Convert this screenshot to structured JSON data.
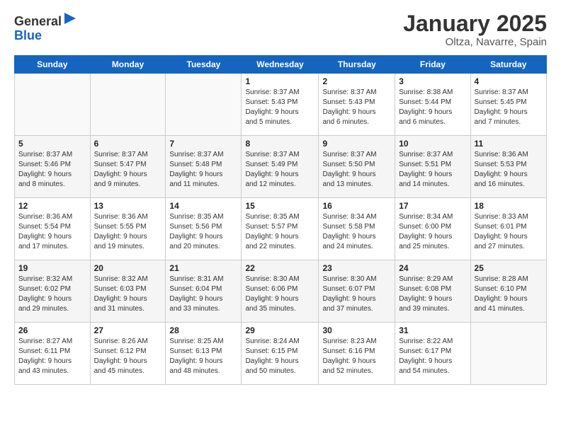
{
  "logo": {
    "general": "General",
    "blue": "Blue"
  },
  "title": "January 2025",
  "subtitle": "Oltza, Navarre, Spain",
  "weekdays": [
    "Sunday",
    "Monday",
    "Tuesday",
    "Wednesday",
    "Thursday",
    "Friday",
    "Saturday"
  ],
  "weeks": [
    [
      {
        "day": "",
        "info": ""
      },
      {
        "day": "",
        "info": ""
      },
      {
        "day": "",
        "info": ""
      },
      {
        "day": "1",
        "info": "Sunrise: 8:37 AM\nSunset: 5:43 PM\nDaylight: 9 hours\nand 5 minutes."
      },
      {
        "day": "2",
        "info": "Sunrise: 8:37 AM\nSunset: 5:43 PM\nDaylight: 9 hours\nand 6 minutes."
      },
      {
        "day": "3",
        "info": "Sunrise: 8:38 AM\nSunset: 5:44 PM\nDaylight: 9 hours\nand 6 minutes."
      },
      {
        "day": "4",
        "info": "Sunrise: 8:37 AM\nSunset: 5:45 PM\nDaylight: 9 hours\nand 7 minutes."
      }
    ],
    [
      {
        "day": "5",
        "info": "Sunrise: 8:37 AM\nSunset: 5:46 PM\nDaylight: 9 hours\nand 8 minutes."
      },
      {
        "day": "6",
        "info": "Sunrise: 8:37 AM\nSunset: 5:47 PM\nDaylight: 9 hours\nand 9 minutes."
      },
      {
        "day": "7",
        "info": "Sunrise: 8:37 AM\nSunset: 5:48 PM\nDaylight: 9 hours\nand 11 minutes."
      },
      {
        "day": "8",
        "info": "Sunrise: 8:37 AM\nSunset: 5:49 PM\nDaylight: 9 hours\nand 12 minutes."
      },
      {
        "day": "9",
        "info": "Sunrise: 8:37 AM\nSunset: 5:50 PM\nDaylight: 9 hours\nand 13 minutes."
      },
      {
        "day": "10",
        "info": "Sunrise: 8:37 AM\nSunset: 5:51 PM\nDaylight: 9 hours\nand 14 minutes."
      },
      {
        "day": "11",
        "info": "Sunrise: 8:36 AM\nSunset: 5:53 PM\nDaylight: 9 hours\nand 16 minutes."
      }
    ],
    [
      {
        "day": "12",
        "info": "Sunrise: 8:36 AM\nSunset: 5:54 PM\nDaylight: 9 hours\nand 17 minutes."
      },
      {
        "day": "13",
        "info": "Sunrise: 8:36 AM\nSunset: 5:55 PM\nDaylight: 9 hours\nand 19 minutes."
      },
      {
        "day": "14",
        "info": "Sunrise: 8:35 AM\nSunset: 5:56 PM\nDaylight: 9 hours\nand 20 minutes."
      },
      {
        "day": "15",
        "info": "Sunrise: 8:35 AM\nSunset: 5:57 PM\nDaylight: 9 hours\nand 22 minutes."
      },
      {
        "day": "16",
        "info": "Sunrise: 8:34 AM\nSunset: 5:58 PM\nDaylight: 9 hours\nand 24 minutes."
      },
      {
        "day": "17",
        "info": "Sunrise: 8:34 AM\nSunset: 6:00 PM\nDaylight: 9 hours\nand 25 minutes."
      },
      {
        "day": "18",
        "info": "Sunrise: 8:33 AM\nSunset: 6:01 PM\nDaylight: 9 hours\nand 27 minutes."
      }
    ],
    [
      {
        "day": "19",
        "info": "Sunrise: 8:32 AM\nSunset: 6:02 PM\nDaylight: 9 hours\nand 29 minutes."
      },
      {
        "day": "20",
        "info": "Sunrise: 8:32 AM\nSunset: 6:03 PM\nDaylight: 9 hours\nand 31 minutes."
      },
      {
        "day": "21",
        "info": "Sunrise: 8:31 AM\nSunset: 6:04 PM\nDaylight: 9 hours\nand 33 minutes."
      },
      {
        "day": "22",
        "info": "Sunrise: 8:30 AM\nSunset: 6:06 PM\nDaylight: 9 hours\nand 35 minutes."
      },
      {
        "day": "23",
        "info": "Sunrise: 8:30 AM\nSunset: 6:07 PM\nDaylight: 9 hours\nand 37 minutes."
      },
      {
        "day": "24",
        "info": "Sunrise: 8:29 AM\nSunset: 6:08 PM\nDaylight: 9 hours\nand 39 minutes."
      },
      {
        "day": "25",
        "info": "Sunrise: 8:28 AM\nSunset: 6:10 PM\nDaylight: 9 hours\nand 41 minutes."
      }
    ],
    [
      {
        "day": "26",
        "info": "Sunrise: 8:27 AM\nSunset: 6:11 PM\nDaylight: 9 hours\nand 43 minutes."
      },
      {
        "day": "27",
        "info": "Sunrise: 8:26 AM\nSunset: 6:12 PM\nDaylight: 9 hours\nand 45 minutes."
      },
      {
        "day": "28",
        "info": "Sunrise: 8:25 AM\nSunset: 6:13 PM\nDaylight: 9 hours\nand 48 minutes."
      },
      {
        "day": "29",
        "info": "Sunrise: 8:24 AM\nSunset: 6:15 PM\nDaylight: 9 hours\nand 50 minutes."
      },
      {
        "day": "30",
        "info": "Sunrise: 8:23 AM\nSunset: 6:16 PM\nDaylight: 9 hours\nand 52 minutes."
      },
      {
        "day": "31",
        "info": "Sunrise: 8:22 AM\nSunset: 6:17 PM\nDaylight: 9 hours\nand 54 minutes."
      },
      {
        "day": "",
        "info": ""
      }
    ]
  ]
}
